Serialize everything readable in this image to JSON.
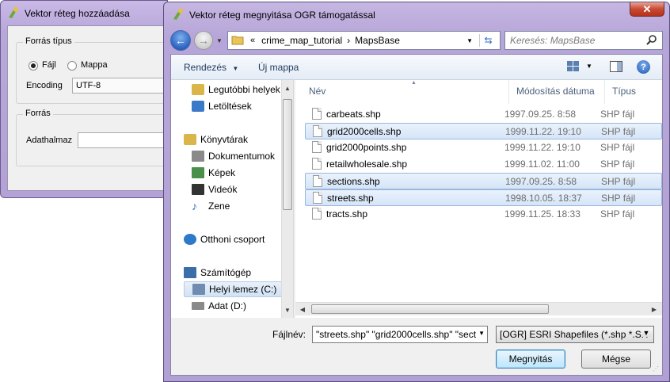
{
  "source_dialog": {
    "title": "Vektor réteg hozzáadása",
    "source_type_group": "Forrás típus",
    "radio_file": "Fájl",
    "radio_folder": "Mappa",
    "encoding_label": "Encoding",
    "encoding_value": "UTF-8",
    "source_group": "Forrás",
    "dataset_label": "Adathalmaz",
    "dataset_value": ""
  },
  "file_dialog": {
    "title": "Vektor réteg megnyitása OGR támogatással",
    "close_glyph": "✕",
    "back_glyph": "←",
    "forward_glyph": "→",
    "breadcrumb": [
      "«",
      "crime_map_tutorial",
      "›",
      "MapsBase"
    ],
    "search_placeholder": "Keresés: MapsBase",
    "toolbar": {
      "organize": "Rendezés",
      "new_folder": "Új mappa",
      "help": "?"
    },
    "nav_items": [
      {
        "label": "Legutóbbi helyek",
        "icon": "recent-places-icon",
        "color": "#d9b54a"
      },
      {
        "label": "Letöltések",
        "icon": "downloads-icon",
        "color": "#3a78c8"
      },
      {
        "label": "Könyvtárak",
        "icon": "libraries-icon",
        "color": "#d9b54a"
      },
      {
        "label": "Dokumentumok",
        "icon": "documents-icon",
        "color": "#8a8a8a"
      },
      {
        "label": "Képek",
        "icon": "pictures-icon",
        "color": "#4a8f4a"
      },
      {
        "label": "Videók",
        "icon": "videos-icon",
        "color": "#333333"
      },
      {
        "label": "Zene",
        "icon": "music-icon",
        "color": "#2a6bc4"
      },
      {
        "label": "Otthoni csoport",
        "icon": "homegroup-icon",
        "color": "#2f79c9"
      },
      {
        "label": "Számítógép",
        "icon": "computer-icon",
        "color": "#3a6ea8"
      },
      {
        "label": "Helyi lemez (C:)",
        "icon": "local-disk-icon",
        "color": "#6e8db0"
      },
      {
        "label": "Adat (D:)",
        "icon": "data-disk-icon",
        "color": "#8a8a8a"
      }
    ],
    "columns": {
      "name": "Név",
      "date": "Módosítás dátuma",
      "type": "Típus"
    },
    "files": [
      {
        "name": "carbeats.shp",
        "date": "1997.09.25. 8:58",
        "type": "SHP fájl",
        "selected": false
      },
      {
        "name": "grid2000cells.shp",
        "date": "1999.11.22. 19:10",
        "type": "SHP fájl",
        "selected": true
      },
      {
        "name": "grid2000points.shp",
        "date": "1999.11.22. 19:10",
        "type": "SHP fájl",
        "selected": false
      },
      {
        "name": "retailwholesale.shp",
        "date": "1999.11.02. 11:00",
        "type": "SHP fájl",
        "selected": false
      },
      {
        "name": "sections.shp",
        "date": "1997.09.25. 8:58",
        "type": "SHP fájl",
        "selected": true
      },
      {
        "name": "streets.shp",
        "date": "1998.10.05. 18:37",
        "type": "SHP fájl",
        "selected": true
      },
      {
        "name": "tracts.shp",
        "date": "1999.11.25. 18:33",
        "type": "SHP fájl",
        "selected": false
      }
    ],
    "filename_label": "Fájlnév:",
    "filename_value": "\"streets.shp\" \"grid2000cells.shp\" \"sect",
    "filetype_value": "[OGR] ESRI Shapefiles (*.shp *.SH",
    "open_button": "Megnyitás",
    "cancel_button": "Mégse"
  }
}
